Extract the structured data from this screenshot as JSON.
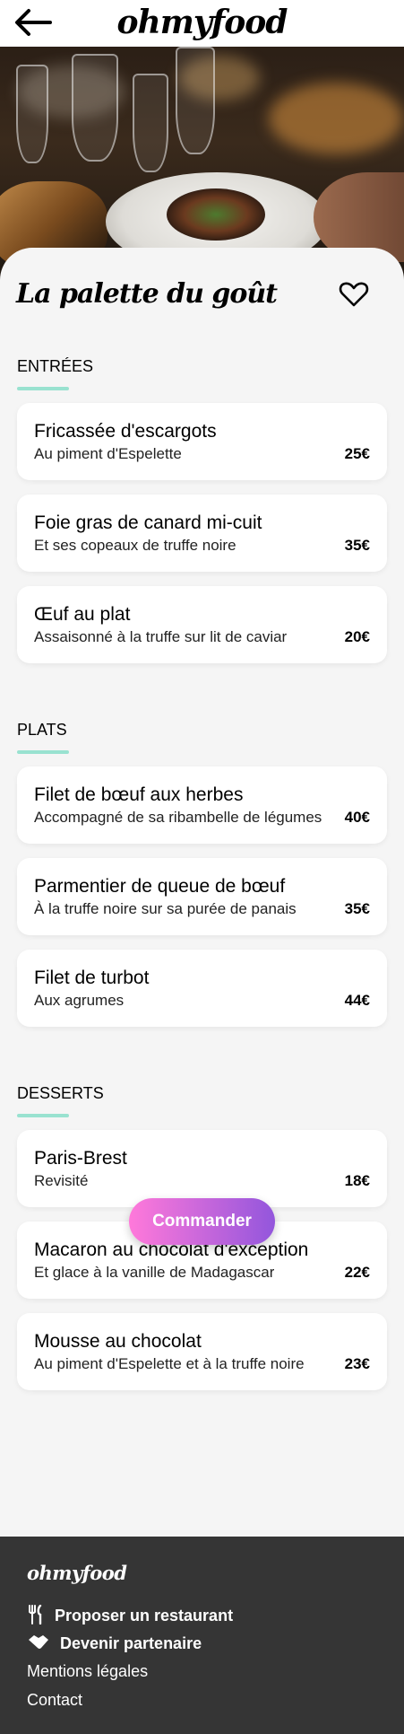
{
  "header": {
    "logo": "ohmyfood",
    "back_icon": "arrow-left-icon"
  },
  "hero": {
    "alt": "restaurant-dish-photo"
  },
  "restaurant": {
    "title": "La palette du goût",
    "favorite_icon": "heart-outline-icon"
  },
  "sections": [
    {
      "title": "ENTRÉES",
      "items": [
        {
          "name": "Fricassée d'escargots",
          "desc": "Au piment d'Espelette",
          "price": "25€"
        },
        {
          "name": "Foie gras de canard mi-cuit",
          "desc": "Et ses copeaux de truffe noire",
          "price": "35€"
        },
        {
          "name": "Œuf au plat",
          "desc": "Assaisonné à la truffe sur lit de caviar",
          "price": "20€"
        }
      ]
    },
    {
      "title": "PLATS",
      "items": [
        {
          "name": "Filet de bœuf aux herbes",
          "desc": "Accompagné de sa ribambelle de légumes",
          "price": "40€"
        },
        {
          "name": "Parmentier de queue de bœuf",
          "desc": "À la truffe noire sur sa purée de panais",
          "price": "35€"
        },
        {
          "name": "Filet de turbot",
          "desc": "Aux agrumes",
          "price": "44€"
        }
      ]
    },
    {
      "title": "DESSERTS",
      "items": [
        {
          "name": "Paris-Brest",
          "desc": "Revisité",
          "price": "18€"
        },
        {
          "name": "Macaron au chocolat d'exception",
          "desc": "Et glace à la vanille de Madagascar",
          "price": "22€"
        },
        {
          "name": "Mousse au chocolat",
          "desc": "Au piment d'Espelette et à la truffe noire",
          "price": "23€"
        }
      ]
    }
  ],
  "order_button": "Commander",
  "footer": {
    "logo": "ohmyfood",
    "links": [
      {
        "label": "Proposer un restaurant",
        "icon": "utensils-icon"
      },
      {
        "label": "Devenir partenaire",
        "icon": "handshake-icon"
      },
      {
        "label": "Mentions légales"
      },
      {
        "label": "Contact"
      }
    ]
  },
  "colors": {
    "accent": "#99e2d0",
    "button_start": "#ff79da",
    "button_end": "#9356dc",
    "footer_bg": "#353535"
  }
}
